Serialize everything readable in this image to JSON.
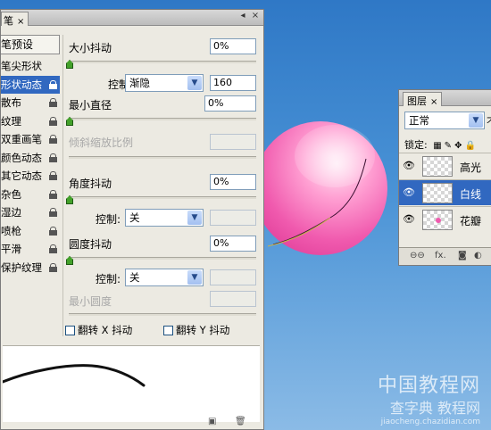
{
  "brush_panel": {
    "tab_label": "笔",
    "list_header": "笔预设",
    "items": [
      {
        "label": "笔尖形状",
        "lock": false
      },
      {
        "label": "形状动态",
        "lock": true,
        "selected": true
      },
      {
        "label": "散布",
        "lock": true
      },
      {
        "label": "纹理",
        "lock": true
      },
      {
        "label": "双重画笔",
        "lock": true
      },
      {
        "label": "颜色动态",
        "lock": true
      },
      {
        "label": "其它动态",
        "lock": true
      },
      {
        "label": "杂色",
        "lock": true
      },
      {
        "label": "湿边",
        "lock": true
      },
      {
        "label": "喷枪",
        "lock": true
      },
      {
        "label": "平滑",
        "lock": true
      },
      {
        "label": "保护纹理",
        "lock": true
      }
    ],
    "size_jitter": {
      "label": "大小抖动",
      "value": "0%",
      "slider": 0
    },
    "size_control": {
      "label": "控制:",
      "option": "渐隐",
      "value": "160"
    },
    "min_diameter": {
      "label": "最小直径",
      "value": "0%",
      "slider": 0
    },
    "tilt_scale": {
      "label": "倾斜缩放比例",
      "value": ""
    },
    "angle_jitter": {
      "label": "角度抖动",
      "value": "0%",
      "slider": 0
    },
    "angle_control": {
      "label": "控制:",
      "option": "关",
      "value": ""
    },
    "roundness_jitter": {
      "label": "圆度抖动",
      "value": "0%",
      "slider": 0
    },
    "roundness_control": {
      "label": "控制:",
      "option": "关",
      "value": ""
    },
    "min_roundness": {
      "label": "最小圆度",
      "value": ""
    },
    "flip_x": {
      "label": "翻转 X 抖动",
      "checked": false
    },
    "flip_y": {
      "label": "翻转 Y 抖动",
      "checked": false
    }
  },
  "layers_panel": {
    "tab_label": "图层",
    "blend_mode": "正常",
    "opacity_label": "不",
    "lock_label": "锁定:",
    "layers": [
      {
        "name": "高光",
        "visible": true,
        "selected": false
      },
      {
        "name": "白线",
        "visible": true,
        "selected": true
      },
      {
        "name": "花瓣",
        "visible": true,
        "selected": false
      }
    ]
  },
  "watermark": {
    "line1": "中国教程网",
    "line2": "查字典 教程网",
    "line3": "jiaocheng.chazidian.com"
  },
  "colors": {
    "selection": "#3168c0",
    "panel_bg": "#eceae2",
    "sphere_pink": "#f05aae",
    "background_blue": "#2f78c6"
  }
}
